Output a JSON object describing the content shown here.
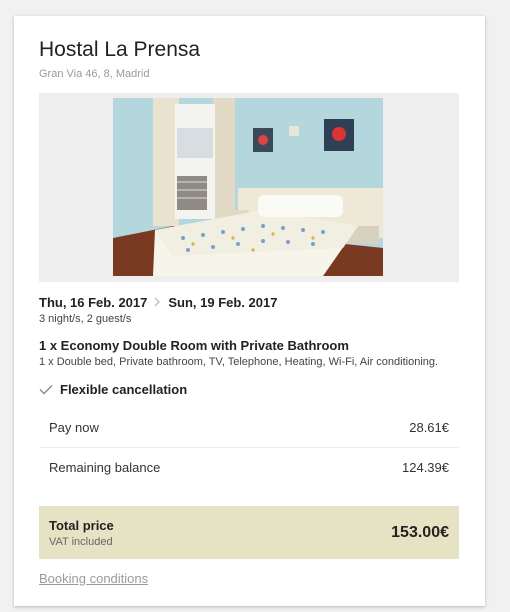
{
  "hotel": {
    "name": "Hostal La Prensa",
    "address": "Gran Via 46, 8, Madrid"
  },
  "stay": {
    "checkin": "Thu, 16 Feb. 2017",
    "checkout": "Sun, 19 Feb. 2017",
    "summary": "3 night/s, 2 guest/s"
  },
  "room": {
    "title": "1 x Economy Double Room with Private Bathroom",
    "features": "1 x Double bed, Private bathroom, TV, Telephone, Heating, Wi-Fi, Air conditioning."
  },
  "cancellation": {
    "label": "Flexible cancellation",
    "icon": "check-icon"
  },
  "payments": [
    {
      "label": "Pay now",
      "amount": "28.61€"
    },
    {
      "label": "Remaining balance",
      "amount": "124.39€"
    }
  ],
  "total": {
    "label": "Total price",
    "note": "VAT included",
    "amount": "153.00€"
  },
  "links": {
    "booking_conditions": "Booking conditions"
  },
  "colors": {
    "total_bg": "#e6e2c4",
    "muted_text": "#9a9a9a"
  }
}
